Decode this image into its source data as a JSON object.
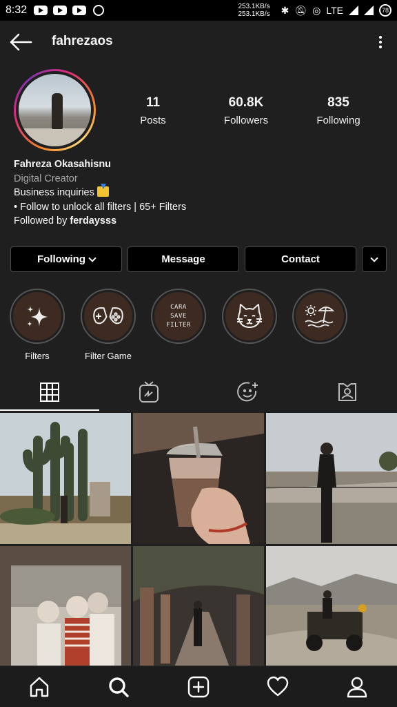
{
  "status_bar": {
    "time": "8:32",
    "speed_up": "253.1KB/s",
    "speed_down": "253.1KB/s",
    "network": "LTE",
    "battery": "78",
    "icons": [
      "youtube-icon",
      "youtube-icon",
      "youtube-icon",
      "whatsapp-icon",
      "bluetooth-icon",
      "mute-icon",
      "hotspot-icon",
      "signal-icon",
      "battery-icon"
    ]
  },
  "header": {
    "username": "fahrezaos"
  },
  "stats": [
    {
      "value": "11",
      "label": "Posts"
    },
    {
      "value": "60.8K",
      "label": "Followers"
    },
    {
      "value": "835",
      "label": "Following"
    }
  ],
  "bio": {
    "name": "Fahreza Okasahisnu",
    "category": "Digital Creator",
    "line1": "Business inquiries",
    "line2": "• Follow to unlock all filters | 65+ Filters",
    "followed_prefix": "Followed by ",
    "followed_user": "ferdaysss"
  },
  "buttons": {
    "following": "Following",
    "message": "Message",
    "contact": "Contact"
  },
  "highlights": [
    {
      "label": "Filters",
      "icon": "sparkles-icon"
    },
    {
      "label": "Filter Game",
      "icon": "gamepad-icon"
    },
    {
      "label": "",
      "icon": "text",
      "text_line1": "CARA",
      "text_line2": "SAVE",
      "text_line3": "FILTER"
    },
    {
      "label": "",
      "icon": "cat-icon"
    },
    {
      "label": "",
      "icon": "beach-icon"
    }
  ],
  "tabs": [
    "grid-icon",
    "igtv-icon",
    "effects-icon",
    "tagged-icon"
  ],
  "bottom_nav": [
    "home-icon",
    "search-icon",
    "add-icon",
    "heart-icon",
    "profile-icon"
  ],
  "colors": {
    "background": "#1f1f1f",
    "button_bg": "#000000",
    "highlight_bg": "#3d2b22",
    "story_ring_start": "#f58529",
    "story_ring_end": "#dd2a7b"
  }
}
